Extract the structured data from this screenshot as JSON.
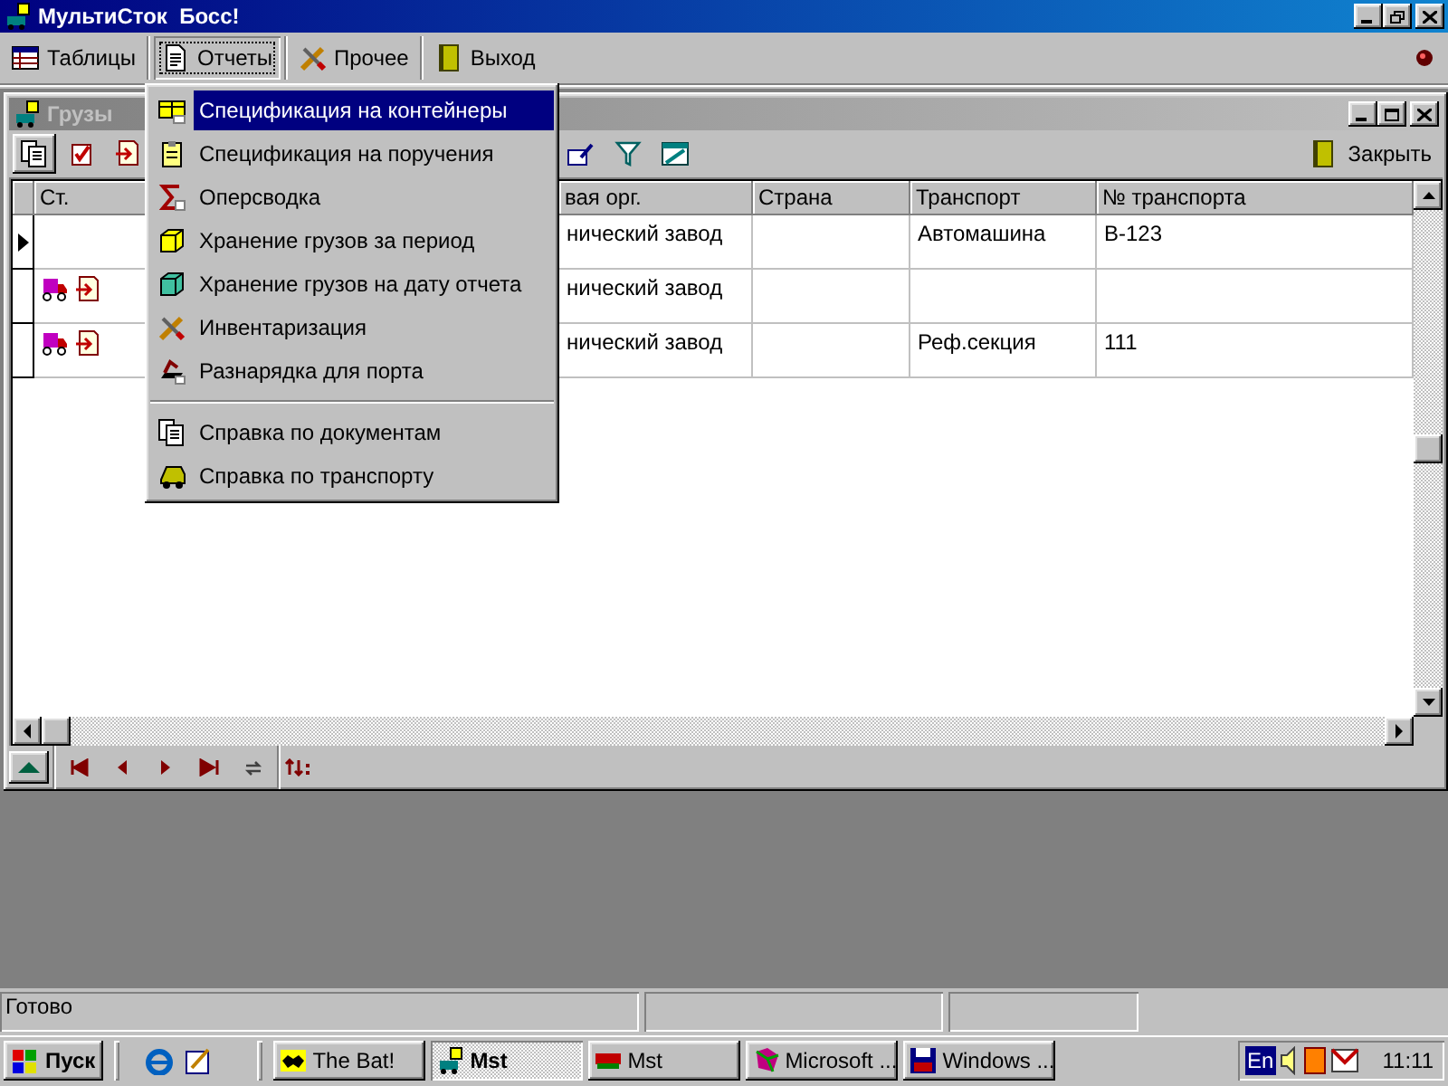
{
  "window": {
    "title": "МультиСток  Босс!"
  },
  "toolbar": [
    {
      "label": "Таблицы",
      "selected": false
    },
    {
      "label": "Отчеты",
      "selected": true
    },
    {
      "label": "Прочее",
      "selected": false
    },
    {
      "label": "Выход",
      "selected": false
    }
  ],
  "menu": [
    {
      "kind": "item",
      "label": "Спецификация на контейнеры",
      "selected": true
    },
    {
      "kind": "item",
      "label": "Спецификация на поручения",
      "selected": false
    },
    {
      "kind": "item",
      "label": "Оперсводка",
      "selected": false
    },
    {
      "kind": "item",
      "label": "Хранение грузов за период",
      "selected": false
    },
    {
      "kind": "item",
      "label": "Хранение грузов на дату отчета",
      "selected": false
    },
    {
      "kind": "item",
      "label": "Инвентаризация",
      "selected": false
    },
    {
      "kind": "item",
      "label": "Разнарядка для порта",
      "selected": false
    },
    {
      "kind": "separator"
    },
    {
      "kind": "item",
      "label": "Справка по документам",
      "selected": false
    },
    {
      "kind": "item",
      "label": "Справка по транспорту",
      "selected": false
    }
  ],
  "child_window": {
    "title": "Грузы",
    "close_button": "Закрыть",
    "table": {
      "columns": [
        "Ст.",
        "вая орг.",
        "Страна",
        "Транспорт",
        "№ транспорта"
      ],
      "rows": [
        {
          "selected": true,
          "status_icons": false,
          "column_3": "нический завод",
          "transport": "Автомашина",
          "transport_no": "В-123"
        },
        {
          "selected": false,
          "status_icons": true,
          "column_3": "нический завод"
        },
        {
          "selected": false,
          "status_icons": true,
          "column_3": "нический завод",
          "transport": "Реф.секция",
          "transport_no": "111"
        }
      ]
    }
  },
  "status_bar": {
    "text": "Готово"
  },
  "taskbar": {
    "start": "Пуск",
    "tasks": [
      {
        "label": "The Bat!",
        "selected": false
      },
      {
        "label": "Mst",
        "selected": true
      },
      {
        "label": "Mst",
        "selected": false
      },
      {
        "label": "Microsoft ...",
        "selected": false
      },
      {
        "label": "Windows ...",
        "selected": false
      }
    ],
    "language": "En",
    "clock": "11:11"
  }
}
